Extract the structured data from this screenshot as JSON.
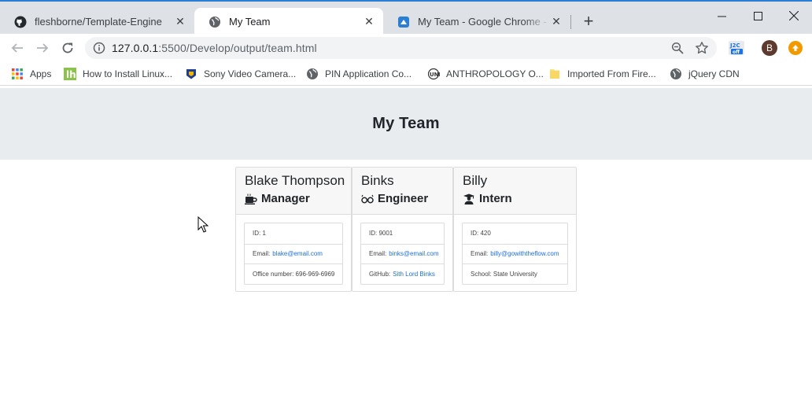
{
  "browser": {
    "tabs": [
      {
        "title": "fleshborne/Template-Engine",
        "favicon": "github-icon"
      },
      {
        "title": "My Team",
        "favicon": "globe-icon"
      },
      {
        "title": "My Team - Google Chrome - Gyazo",
        "favicon": "gyazo-icon"
      }
    ],
    "url": {
      "host": "127.0.0.1",
      "port_path": ":5500/Develop/output/team.html"
    },
    "profile_initial": "B",
    "bookmarks": [
      {
        "label": "Apps",
        "icon": "apps-grid-icon"
      },
      {
        "label": "How to Install Linux...",
        "icon": "linux-hint-icon"
      },
      {
        "label": "Sony Video Camera...",
        "icon": "sony-badge-icon"
      },
      {
        "label": "PIN Application Co...",
        "icon": "globe-icon"
      },
      {
        "label": "ANTHROPOLOGY O...",
        "icon": "anthro-icon"
      },
      {
        "label": "Imported From Fire...",
        "icon": "folder-icon"
      },
      {
        "label": "jQuery CDN",
        "icon": "globe-icon"
      }
    ]
  },
  "page": {
    "heading": "My Team",
    "members": [
      {
        "name": "Blake Thompson",
        "role": "Manager",
        "role_icon": "coffee-mug-icon",
        "id_label": "ID: 1",
        "email_label": "Email:",
        "email": "blake@email.com",
        "extra_label": "Office number: 696-969-6969",
        "extra_link": ""
      },
      {
        "name": "Binks",
        "role": "Engineer",
        "role_icon": "glasses-icon",
        "id_label": "ID: 9001",
        "email_label": "Email:",
        "email": "binks@email.com",
        "extra_label": "GitHub:",
        "extra_link": "Sith Lord Binks"
      },
      {
        "name": "Billy",
        "role": "Intern",
        "role_icon": "graduate-icon",
        "id_label": "ID: 420",
        "email_label": "Email:",
        "email": "billy@gowiththeflow.com",
        "extra_label": "School: State University",
        "extra_link": ""
      }
    ]
  }
}
